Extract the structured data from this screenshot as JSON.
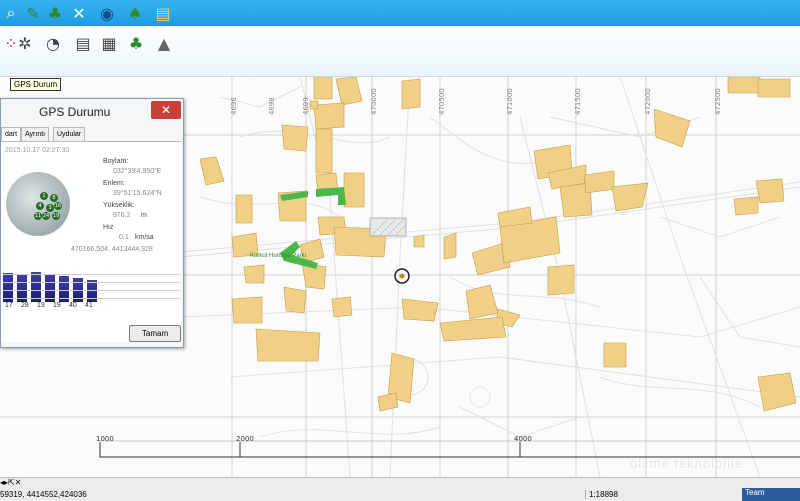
{
  "toolbar_top": {
    "icons": [
      "search-icon",
      "pencil-icon",
      "tree-icon",
      "tools-icon",
      "globe-icon",
      "tree-map-icon",
      "document-icon"
    ]
  },
  "toolbar_second": {
    "icons": [
      "dots-icon",
      "compass-rose-icon",
      "compass-icon",
      "list-document-icon",
      "table-document-icon",
      "bonsai-icon",
      "road-icon"
    ]
  },
  "tooltip": "GPS Durum",
  "dialog": {
    "title": "GPS Durumu",
    "close_label": "✕",
    "tabs": [
      "dart",
      "Ayrıntı",
      "Uydular"
    ],
    "datetime": "2015.10.17 02:27:30",
    "fields": {
      "boylam_label": "Boylam:",
      "boylam_value": "032°39'4.950\"E",
      "enlem_label": "Enlem:",
      "enlem_value": "39°51'15.624\"N",
      "yukseklik_label": "Yükseklik:",
      "yukseklik_value": "976,2",
      "yukseklik_unit": "m",
      "hiz_label": "Hız",
      "hiz_value": "0,1",
      "hiz_unit": "km/sa",
      "coords_value": "470166,504, 4413444,928"
    },
    "satellites": [
      "1",
      "8",
      "4",
      "3",
      "16",
      "24",
      "19",
      "11"
    ],
    "bar_labels": [
      "17",
      "28",
      "13",
      "19",
      "40",
      "41"
    ],
    "signal_strengths": [
      0.9,
      0.85,
      0.95,
      0.88,
      0.8,
      0.75,
      0.7
    ],
    "ok_label": "Tamam"
  },
  "map": {
    "grid_ticks": [
      "4696",
      "4698",
      "4699",
      "470000",
      "470500",
      "471000",
      "471500",
      "472000",
      "472500"
    ],
    "scale_labels": [
      "1000",
      "2000",
      "4000"
    ],
    "place_label": "Korkut Hurisiye Parkı",
    "watermark": "ölçme teknolojile"
  },
  "status": {
    "coordinates": "59319, 4414552,424036",
    "scale": "1:18898",
    "taskbar_label": "Team"
  },
  "colors": {
    "ribbon": "#2aa8e8",
    "building": "#f0cf86",
    "building_stroke": "#c89a3c",
    "park": "#4cb84c",
    "close": "#c8403b"
  }
}
